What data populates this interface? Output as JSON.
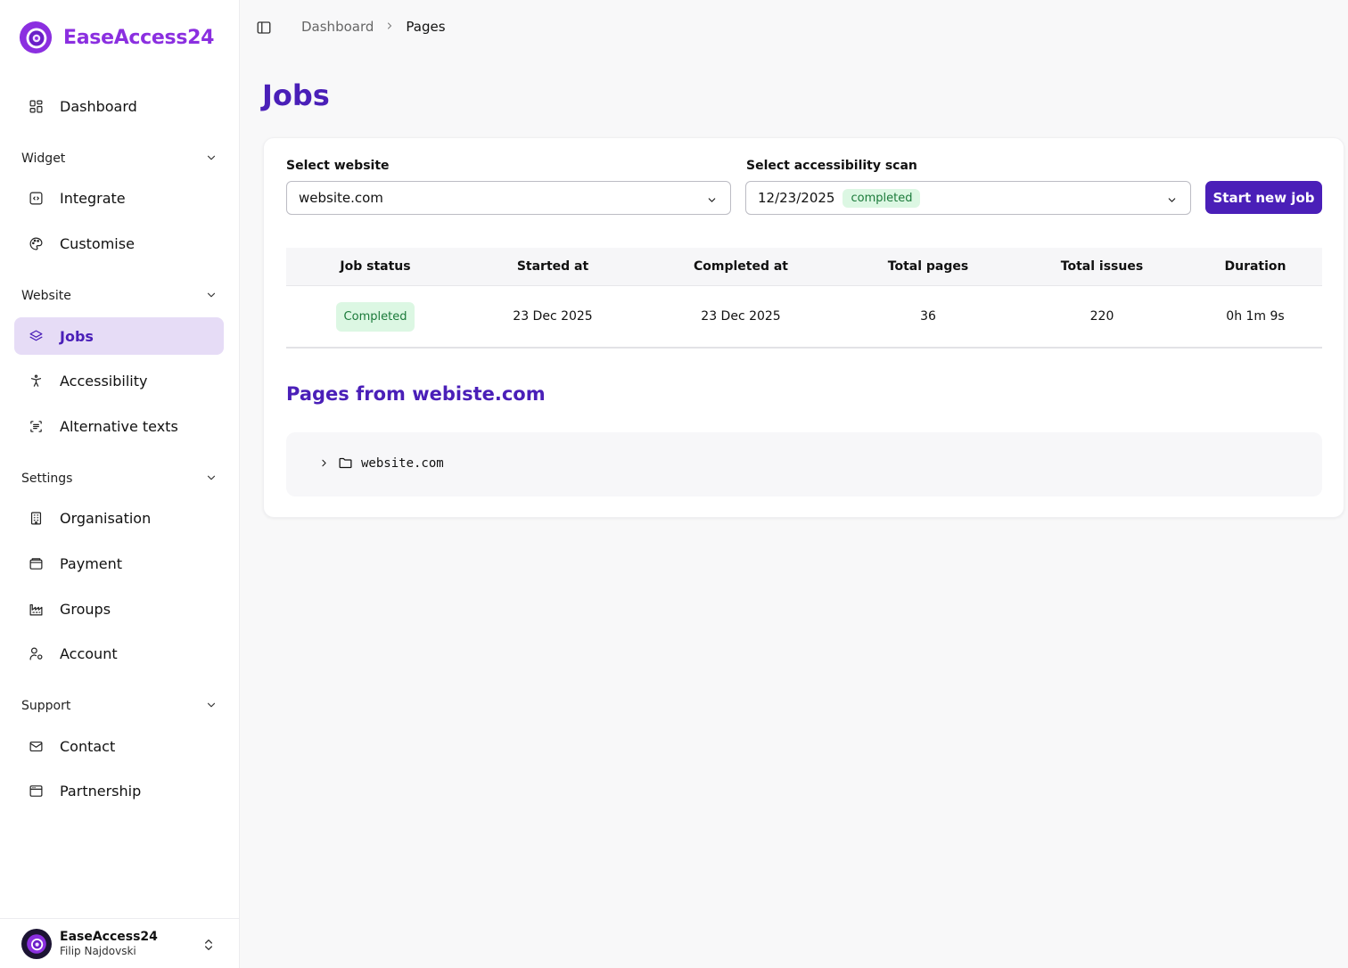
{
  "brand": {
    "name": "EaseAccess24",
    "color": "#8b2fe0"
  },
  "nav": {
    "dashboard": "Dashboard",
    "sections": {
      "widget": "Widget",
      "website": "Website",
      "settings": "Settings",
      "support": "Support"
    },
    "items": {
      "integrate": "Integrate",
      "customise": "Customise",
      "jobs": "Jobs",
      "accessibility": "Accessibility",
      "alt_texts": "Alternative texts",
      "organisation": "Organisation",
      "payment": "Payment",
      "groups": "Groups",
      "account": "Account",
      "contact": "Contact",
      "partnership": "Partnership"
    },
    "active": "jobs"
  },
  "user": {
    "org": "EaseAccess24",
    "name": "Filip Najdovski"
  },
  "breadcrumb": {
    "parent": "Dashboard",
    "current": "Pages"
  },
  "page": {
    "title": "Jobs",
    "accent": "#4a1fb8"
  },
  "filters": {
    "website_label": "Select website",
    "website_value": "website.com",
    "scan_label": "Select accessibility scan",
    "scan_date": "12/23/2025",
    "scan_status": "completed",
    "start_button": "Start new job"
  },
  "table": {
    "headers": [
      "Job status",
      "Started at",
      "Completed at",
      "Total pages",
      "Total issues",
      "Duration"
    ],
    "rows": [
      {
        "status": "Completed",
        "started": "23 Dec 2025",
        "completed": "23 Dec 2025",
        "pages": "36",
        "issues": "220",
        "duration": "0h 1m 9s"
      }
    ]
  },
  "pages_section": {
    "prefix": "Pages from ",
    "site": "webiste.com",
    "tree_root": "website.com"
  }
}
